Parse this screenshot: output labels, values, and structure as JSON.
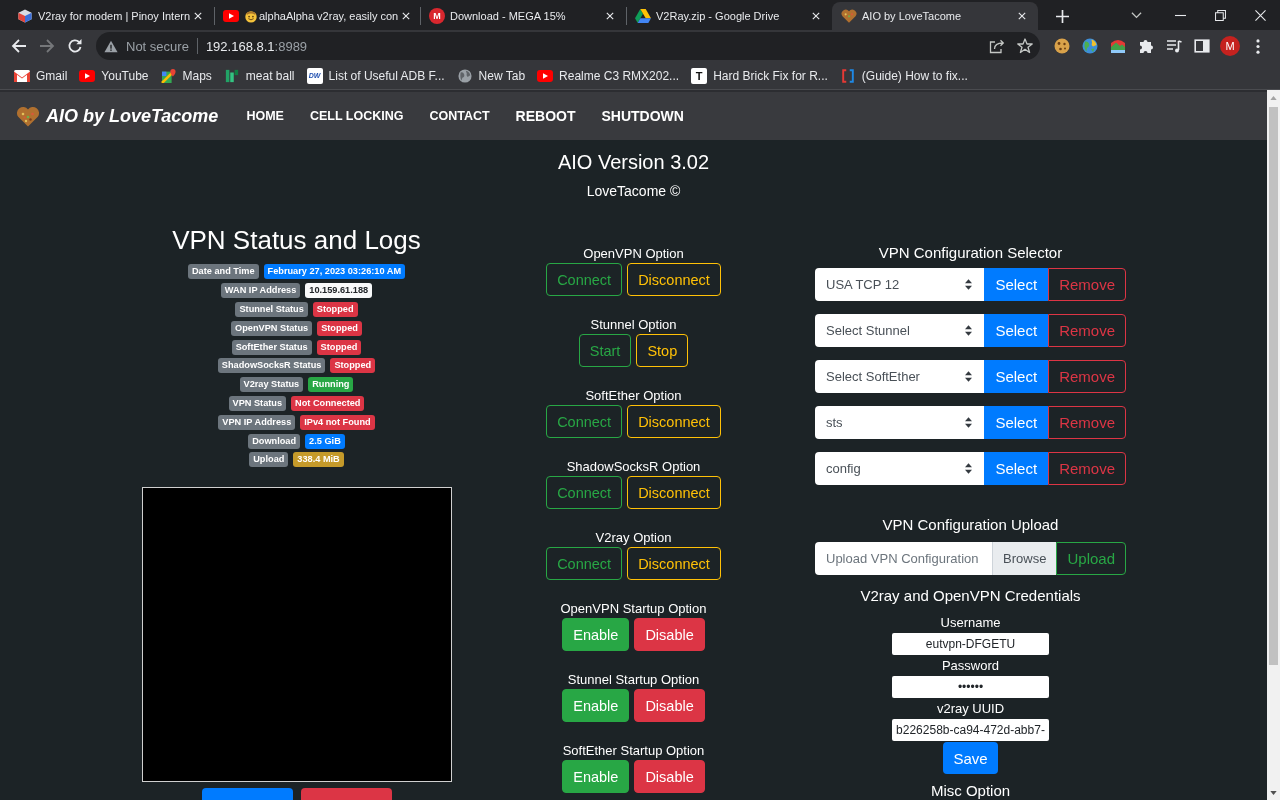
{
  "browser": {
    "tabs": [
      {
        "title": "V2ray for modem | Pinoy Intern",
        "selected": false
      },
      {
        "title": "alphaAlpha v2ray, easily con",
        "selected": false
      },
      {
        "title": "Download - MEGA 15%",
        "icon_letter": "M",
        "selected": false
      },
      {
        "title": "V2Ray.zip - Google Drive",
        "selected": false
      },
      {
        "title": "AIO by LoveTacome",
        "selected": true
      }
    ],
    "forward_disabled": true,
    "address_bar": {
      "security_label": "Not secure",
      "host": "192.168.8.1",
      "port": ":8989"
    },
    "profile_initial": "M",
    "bookmarks": [
      {
        "label": "Gmail"
      },
      {
        "label": "YouTube"
      },
      {
        "label": "Maps"
      },
      {
        "label": "meat ball"
      },
      {
        "label": "List of Useful ADB F...",
        "icon_letter": "DW"
      },
      {
        "label": "New Tab"
      },
      {
        "label": "Realme C3 RMX202..."
      },
      {
        "label": "Hard Brick Fix for R...",
        "icon_letter": "T"
      },
      {
        "label": "(Guide) How to fix..."
      }
    ]
  },
  "page": {
    "brand": "AIO by LoveTacome",
    "nav": [
      {
        "label": "HOME",
        "kind": "link"
      },
      {
        "label": "CELL LOCKING",
        "kind": "link"
      },
      {
        "label": "CONTACT",
        "kind": "link"
      },
      {
        "label": "REBOOT",
        "kind": "action"
      },
      {
        "label": "SHUTDOWN",
        "kind": "action"
      }
    ],
    "version_title": "AIO Version 3.02",
    "credit": "LoveTacome ©",
    "status": {
      "title": "VPN Status and Logs",
      "rows": [
        {
          "label": "Date and Time",
          "value": "February 27, 2023 03:26:10 AM",
          "color": "#007bff"
        },
        {
          "label": "WAN IP Address",
          "value": "10.159.61.188",
          "color": "#f8f9fa"
        },
        {
          "label": "Stunnel Status",
          "value": "Stopped",
          "color": "#dc3545"
        },
        {
          "label": "OpenVPN Status",
          "value": "Stopped",
          "color": "#dc3545"
        },
        {
          "label": "SoftEther Status",
          "value": "Stopped",
          "color": "#dc3545"
        },
        {
          "label": "ShadowSocksR Status",
          "value": "Stopped",
          "color": "#dc3545"
        },
        {
          "label": "V2ray Status",
          "value": "Running",
          "color": "#28a745"
        },
        {
          "label": "VPN Status",
          "value": "Not Connected",
          "color": "#dc3545"
        },
        {
          "label": "VPN IP Address",
          "value": "IPv4 not Found",
          "color": "#dc3545"
        },
        {
          "label": "Download",
          "value": "2.5 GiB",
          "color": "#007bff"
        },
        {
          "label": "Upload",
          "value": "338.4 MiB",
          "color": "#c59a2a"
        }
      ],
      "log_buttons": [
        {
          "kind": "primary"
        },
        {
          "kind": "danger"
        }
      ]
    },
    "options": [
      {
        "title": "OpenVPN Option",
        "kind": "outline",
        "buttons": [
          {
            "label": "Connect",
            "kind": "connect"
          },
          {
            "label": "Disconnect",
            "kind": "disconnect"
          }
        ]
      },
      {
        "title": "Stunnel Option",
        "kind": "outline",
        "buttons": [
          {
            "label": "Start",
            "kind": "start"
          },
          {
            "label": "Stop",
            "kind": "stop"
          }
        ]
      },
      {
        "title": "SoftEther Option",
        "kind": "outline",
        "buttons": [
          {
            "label": "Connect",
            "kind": "connect"
          },
          {
            "label": "Disconnect",
            "kind": "disconnect"
          }
        ]
      },
      {
        "title": "ShadowSocksR Option",
        "kind": "outline",
        "buttons": [
          {
            "label": "Connect",
            "kind": "connect"
          },
          {
            "label": "Disconnect",
            "kind": "disconnect"
          }
        ]
      },
      {
        "title": "V2ray Option",
        "kind": "outline",
        "buttons": [
          {
            "label": "Connect",
            "kind": "connect"
          },
          {
            "label": "Disconnect",
            "kind": "disconnect"
          }
        ]
      },
      {
        "title": "OpenVPN Startup Option",
        "kind": "solid",
        "buttons": [
          {
            "label": "Enable",
            "kind": "enable"
          },
          {
            "label": "Disable",
            "kind": "disable"
          }
        ]
      },
      {
        "title": "Stunnel Startup Option",
        "kind": "solid",
        "buttons": [
          {
            "label": "Enable",
            "kind": "enable"
          },
          {
            "label": "Disable",
            "kind": "disable"
          }
        ]
      },
      {
        "title": "SoftEther Startup Option",
        "kind": "solid",
        "buttons": [
          {
            "label": "Enable",
            "kind": "enable"
          },
          {
            "label": "Disable",
            "kind": "disable"
          }
        ]
      }
    ],
    "config_selector": {
      "title": "VPN Configuration Selector",
      "rows": [
        {
          "value": "USA TCP 12",
          "select_label": "Select",
          "remove_label": "Remove"
        },
        {
          "value": "Select Stunnel",
          "select_label": "Select",
          "remove_label": "Remove"
        },
        {
          "value": "Select SoftEther",
          "select_label": "Select",
          "remove_label": "Remove"
        },
        {
          "value": "sts",
          "select_label": "Select",
          "remove_label": "Remove"
        },
        {
          "value": "config",
          "select_label": "Select",
          "remove_label": "Remove"
        }
      ]
    },
    "config_upload": {
      "title": "VPN Configuration Upload",
      "placeholder": "Upload VPN Configuration",
      "browse_label": "Browse",
      "upload_label": "Upload"
    },
    "credentials": {
      "title": "V2ray and OpenVPN Credentials",
      "fields": [
        {
          "label": "Username",
          "value": "eutvpn-DFGETU"
        },
        {
          "label": "Password",
          "value": "••••••"
        },
        {
          "label": "v2ray UUID",
          "value": "b226258b-ca94-472d-abb7-"
        }
      ],
      "save_label": "Save"
    },
    "misc_title": "Misc Option"
  }
}
